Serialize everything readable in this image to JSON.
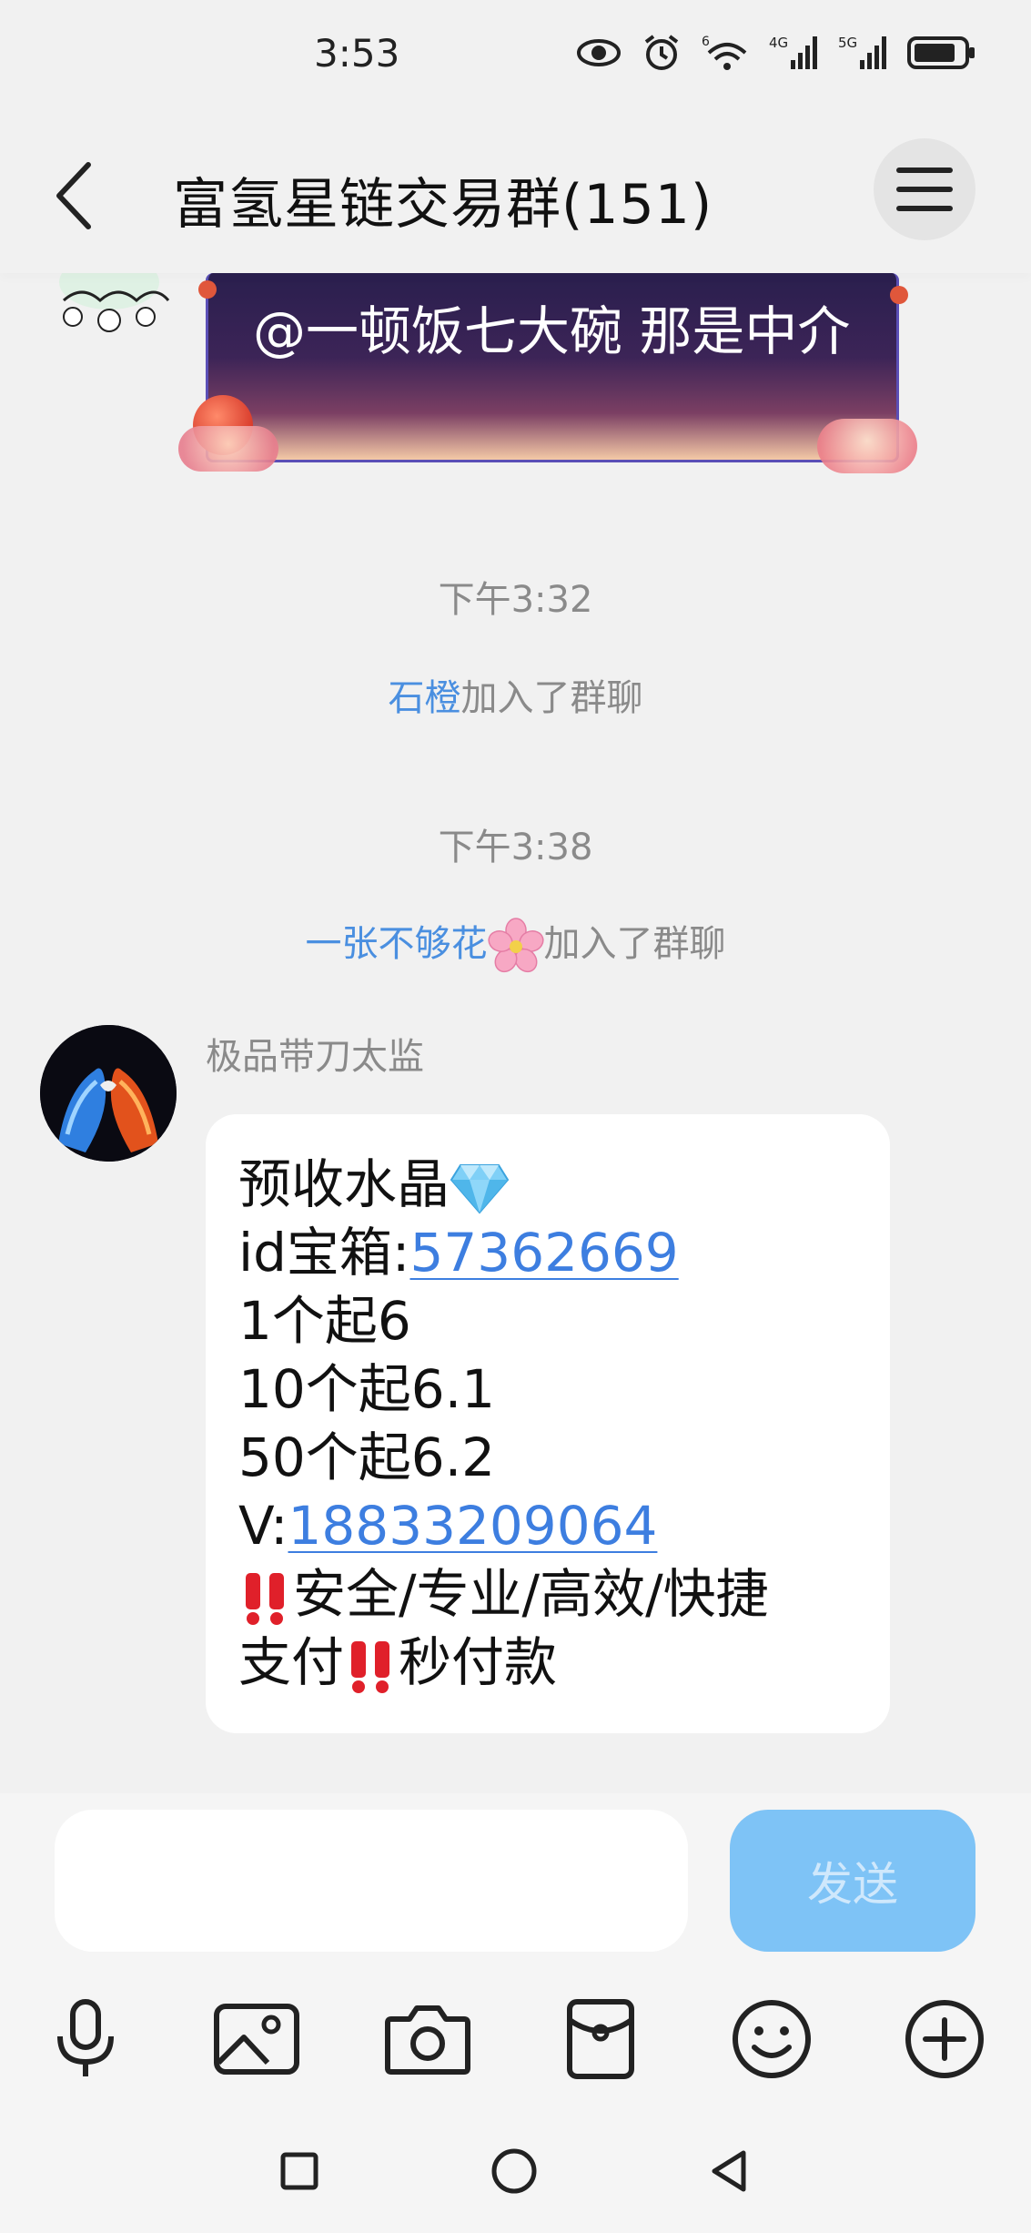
{
  "status_bar": {
    "time": "3:53",
    "icons": [
      "eye-icon",
      "alarm-icon",
      "wifi-6-icon",
      "signal-4g-icon",
      "signal-5g-icon",
      "battery-icon"
    ]
  },
  "header": {
    "title": "富氢星链交易群(151)",
    "back_icon": "chevron-left-icon",
    "menu_icon": "hamburger-menu-icon"
  },
  "messages": {
    "fancy_bubble_text": "@一顿饭七大碗 那是中介",
    "timestamp_1": "下午3:32",
    "join_1_name": "石橙",
    "join_1_text": "加入了群聊",
    "timestamp_2": "下午3:38",
    "join_2_name": "一张不够花",
    "join_2_text": "加入了群聊",
    "sender_name": "极品带刀太监",
    "bubble": {
      "line1": "预收水晶",
      "line2_prefix": "id宝箱:",
      "line2_link": "57362669",
      "line3": "1个起6",
      "line4": "10个起6.1",
      "line5": "50个起6.2",
      "line6_prefix": "V:",
      "line6_link": "18833209064",
      "line7": "安全/专业/高效/快捷",
      "line8_a": "支付",
      "line8_b": "秒付款"
    }
  },
  "input": {
    "placeholder": "",
    "send_label": "发送"
  },
  "toolbar": {
    "tools": [
      "microphone-icon",
      "image-icon",
      "camera-icon",
      "red-packet-icon",
      "emoji-icon",
      "plus-icon"
    ]
  },
  "navbar": {
    "buttons": [
      "recent-apps-icon",
      "home-icon",
      "back-triangle-icon"
    ]
  },
  "colors": {
    "link": "#3d7ee0",
    "name_highlight": "#4a8fe0",
    "send_button": "#7ec3f6",
    "background": "#f1f1f1"
  }
}
